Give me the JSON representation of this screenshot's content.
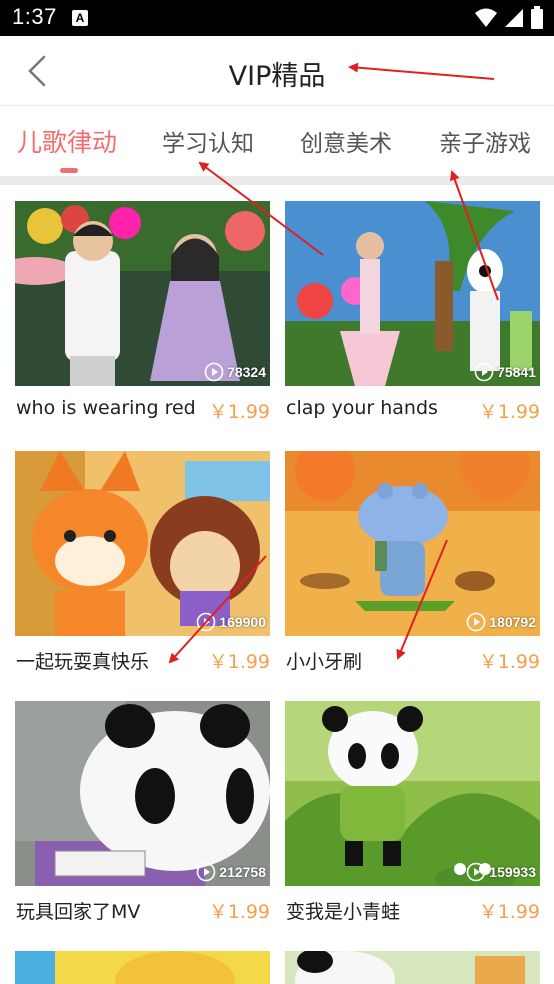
{
  "status_bar": {
    "time": "1:37",
    "notification_icon": "a-box-icon"
  },
  "header": {
    "title": "VIP精品",
    "back_icon": "chevron-left-icon"
  },
  "tabs": [
    {
      "label": "儿歌律动",
      "active": true
    },
    {
      "label": "学习认知",
      "active": false
    },
    {
      "label": "创意美术",
      "active": false
    },
    {
      "label": "亲子游戏",
      "active": false
    }
  ],
  "videos": [
    {
      "title": "who is wearing red",
      "price": "￥1.99",
      "plays": "78324"
    },
    {
      "title": "clap your hands",
      "price": "￥1.99",
      "plays": "75841"
    },
    {
      "title": "一起玩耍真快乐",
      "price": "￥1.99",
      "plays": "169900"
    },
    {
      "title": "小小牙刷",
      "price": "￥1.99",
      "plays": "180792"
    },
    {
      "title": "玩具回家了MV",
      "price": "￥1.99",
      "plays": "212758"
    },
    {
      "title": "变我是小青蛙",
      "price": "￥1.99",
      "plays": "159933"
    }
  ],
  "colors": {
    "accent": "#f56c6c",
    "price": "#f5a04a",
    "annotation": "#e02020"
  }
}
